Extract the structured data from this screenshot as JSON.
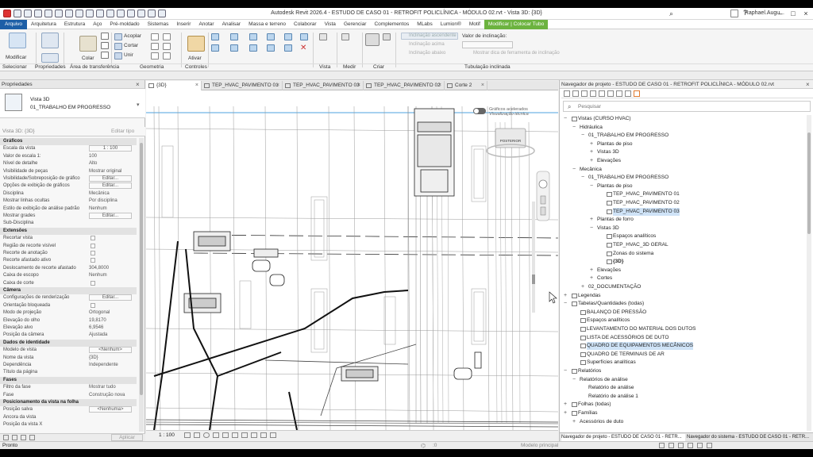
{
  "app": {
    "title": "Autodesk Revit 2026.4 - ESTUDO DE CASO 01 - RETROFIT POLICLÍNICA - MÓDULO 02.rvt - Vista 3D: {3D}",
    "user": "Raphael.Augu..."
  },
  "ribbon_tabs": [
    "Arquivo",
    "Arquitetura",
    "Estrutura",
    "Aço",
    "Pré-moldado",
    "Sistemas",
    "Inserir",
    "Anotar",
    "Analisar",
    "Massa e terreno",
    "Colaborar",
    "Vista",
    "Gerenciar",
    "Complementos",
    "MLabs",
    "Lumion®",
    "Motif",
    "Modificar | Colocar Tubo"
  ],
  "ribbon": {
    "modify": "Modificar",
    "paste": "Colar",
    "cope": "Acoplar",
    "cut": "Cortar",
    "join": "Unir",
    "activate": "Ativar",
    "slope_title": "Valor de inclinação:",
    "slope_up": "Inclinação ascendente",
    "slope_up2": "Inclinação acima",
    "slope_down": "Inclinação abaixo",
    "slope_tool": "Mostrar dica de ferramenta de inclinação",
    "panels": [
      "Selecionar",
      "Propriedades",
      "Área de transferência",
      "Geometria",
      "Controles",
      "Vista",
      "Medir",
      "Criar",
      "Tubulação inclinada"
    ]
  },
  "properties": {
    "header": "Propriedades",
    "type_family": "Vista 3D",
    "type_name": "01_TRABALHO EM PROGRESSO",
    "selector": "Vista 3D: {3D}",
    "edit_type": "Editar tipo",
    "apply": "Aplicar",
    "rows": [
      {
        "k": "Gráficos",
        "grp": true
      },
      {
        "k": "Escala da vista",
        "v": "1 : 100",
        "box": true
      },
      {
        "k": "Valor de escala   1:",
        "v": "100"
      },
      {
        "k": "Nível de detalhe",
        "v": "Alto"
      },
      {
        "k": "Visibilidade de peças",
        "v": "Mostrar original"
      },
      {
        "k": "Visibilidade/Sobreposição de gráfico",
        "v": "Editar...",
        "box": true
      },
      {
        "k": "Opções de exibição de gráficos",
        "v": "Editar...",
        "box": true
      },
      {
        "k": "Disciplina",
        "v": "Mecânica"
      },
      {
        "k": "Mostrar linhas ocultas",
        "v": "Por disciplina"
      },
      {
        "k": "Estilo de exibição de análise padrão",
        "v": "Nenhum"
      },
      {
        "k": "Mostrar grades",
        "v": "Editar...",
        "box": true
      },
      {
        "k": "Sub-Disciplina",
        "v": ""
      },
      {
        "k": "Extensões",
        "grp": true
      },
      {
        "k": "Recortar vista",
        "chk": true
      },
      {
        "k": "Região de recorte visível",
        "chk": true
      },
      {
        "k": "Recorte de anotação",
        "chk": true
      },
      {
        "k": "Recorte afastado ativo",
        "chk": true
      },
      {
        "k": "Deslocamento de recorte afastado",
        "v": "304,8000"
      },
      {
        "k": "Caixa de escopo",
        "v": "Nenhum"
      },
      {
        "k": "Caixa de corte",
        "chk": true
      },
      {
        "k": "Câmera",
        "grp": true
      },
      {
        "k": "Configurações de renderização",
        "v": "Editar...",
        "box": true
      },
      {
        "k": "Orientação bloqueada",
        "chk": true
      },
      {
        "k": "Modo de projeção",
        "v": "Ortogonal"
      },
      {
        "k": "Elevação do olho",
        "v": "19,8170"
      },
      {
        "k": "Elevação alvo",
        "v": "6,9546"
      },
      {
        "k": "Posição da câmera",
        "v": "Ajustada"
      },
      {
        "k": "Dados de identidade",
        "grp": true
      },
      {
        "k": "Modelo de vista",
        "v": "<Nenhum>",
        "box": true
      },
      {
        "k": "Nome da vista",
        "v": "{3D}"
      },
      {
        "k": "Dependência",
        "v": "Independente"
      },
      {
        "k": "Título da página",
        "v": ""
      },
      {
        "k": "Fases",
        "grp": true
      },
      {
        "k": "Filtro da fase",
        "v": "Mostrar tudo"
      },
      {
        "k": "Fase",
        "v": "Construção nova"
      },
      {
        "k": "Posicionamento da vista na folha",
        "grp": true
      },
      {
        "k": "Posição salva",
        "v": "<Nenhuma>",
        "box": true
      },
      {
        "k": "Âncora da vista",
        "v": ""
      },
      {
        "k": "Posição da vista X",
        "v": ""
      }
    ]
  },
  "view_tabs": [
    "{3D}",
    "TEP_HVAC_PAVIMENTO 01",
    "TEP_HVAC_PAVIMENTO 03",
    "TEP_HVAC_PAVIMENTO 02",
    "Corte 2"
  ],
  "canvas": {
    "toggle_line1": "Gráficos acelerados",
    "toggle_line2": "Visualização técnica",
    "cube_face": "POSTERIOR"
  },
  "viewbar": {
    "scale": "1 : 100"
  },
  "browser": {
    "header": "Navegador de projeto - ESTUDO DE CASO 01 - RETROFIT POLICLÍNICA - MÓDULO 02.rvt",
    "search_placeholder": "Pesquisar",
    "items": [
      {
        "l": "Vistas (CURSO HVAC)",
        "d": 0,
        "t": "−",
        "i": true
      },
      {
        "l": "Hidráulica",
        "d": 1,
        "t": "−"
      },
      {
        "l": "01_TRABALHO EM PROGRESSO",
        "d": 2,
        "t": "−"
      },
      {
        "l": "Plantas de piso",
        "d": 3,
        "t": "+"
      },
      {
        "l": "Vistas 3D",
        "d": 3,
        "t": "+"
      },
      {
        "l": "Elevações",
        "d": 3,
        "t": "+"
      },
      {
        "l": "Mecânica",
        "d": 1,
        "t": "−"
      },
      {
        "l": "01_TRABALHO EM PROGRESSO",
        "d": 2,
        "t": "−"
      },
      {
        "l": "Plantas de piso",
        "d": 3,
        "t": "−"
      },
      {
        "l": "TEP_HVAC_PAVIMENTO 01",
        "d": 4,
        "i": true
      },
      {
        "l": "TEP_HVAC_PAVIMENTO 02",
        "d": 4,
        "i": true
      },
      {
        "l": "TEP_HVAC_PAVIMENTO 03",
        "d": 4,
        "i": true,
        "sel": true
      },
      {
        "l": "Plantas de forro",
        "d": 3,
        "t": "+"
      },
      {
        "l": "Vistas 3D",
        "d": 3,
        "t": "−"
      },
      {
        "l": "Espaços analíticos",
        "d": 4,
        "i": true
      },
      {
        "l": "TEP_HVAC_3D GERAL",
        "d": 4,
        "i": true
      },
      {
        "l": "Zonas do sistema",
        "d": 4,
        "i": true
      },
      {
        "l": "{3D}",
        "d": 4,
        "i": true,
        "bold": true
      },
      {
        "l": "Elevações",
        "d": 3,
        "t": "+"
      },
      {
        "l": "Cortes",
        "d": 3,
        "t": "+"
      },
      {
        "l": "02_DOCUMENTAÇÃO",
        "d": 2,
        "t": "+"
      },
      {
        "l": "Legendas",
        "d": 0,
        "t": "+",
        "i": true
      },
      {
        "l": "Tabelas/Quantidades (todas)",
        "d": 0,
        "t": "−",
        "i": true
      },
      {
        "l": "BALANÇO DE PRESSÃO",
        "d": 1,
        "i": true
      },
      {
        "l": "Espaços analíticos",
        "d": 1,
        "i": true
      },
      {
        "l": "LEVANTAMENTO DO MATERIAL DOS DUTOS",
        "d": 1,
        "i": true
      },
      {
        "l": "LISTA DE ACESSÓRIOS DE DUTO",
        "d": 1,
        "i": true
      },
      {
        "l": "QUADRO DE EQUIPAMENTOS MECÂNICOS",
        "d": 1,
        "i": true,
        "hl": true
      },
      {
        "l": "QUADRO DE TERMINAIS DE AR",
        "d": 1,
        "i": true
      },
      {
        "l": "Superfícies analíticas",
        "d": 1,
        "i": true
      },
      {
        "l": "Relatórios",
        "d": 0,
        "t": "−",
        "i": true
      },
      {
        "l": "Relatórios de análise",
        "d": 1,
        "t": "−"
      },
      {
        "l": "Relatório de análise",
        "d": 2
      },
      {
        "l": "Relatório de análise 1",
        "d": 2
      },
      {
        "l": "Folhas (todas)",
        "d": 0,
        "t": "+",
        "i": true
      },
      {
        "l": "Famílias",
        "d": 0,
        "t": "+",
        "i": true
      },
      {
        "l": "Acessórios de duto",
        "d": 1,
        "t": "+"
      }
    ],
    "tab1": "Navegador de projeto - ESTUDO DE CASO 01 - RETR...",
    "tab2": "Navegador do sistema - ESTUDO DE CASO 01 - RETR..."
  },
  "status": {
    "left": "Pronto",
    "model": "Modelo principal",
    "zero": ":0"
  }
}
